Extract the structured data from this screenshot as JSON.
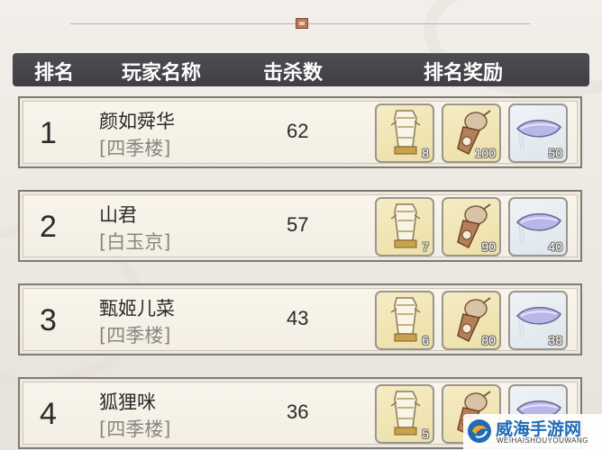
{
  "header": {
    "rank": "排名",
    "player_name": "玩家名称",
    "kills": "击杀数",
    "rewards": "排名奖励"
  },
  "rows": [
    {
      "rank": "1",
      "name": "颜如舜华",
      "guild": "[四季楼]",
      "kills": "62",
      "rewards": [
        "8",
        "100",
        "50"
      ]
    },
    {
      "rank": "2",
      "name": "山君",
      "guild": "[白玉京]",
      "kills": "57",
      "rewards": [
        "7",
        "90",
        "40"
      ]
    },
    {
      "rank": "3",
      "name": "甄姬儿菜",
      "guild": "[四季楼]",
      "kills": "43",
      "rewards": [
        "6",
        "80",
        "38"
      ]
    },
    {
      "rank": "4",
      "name": "狐狸咪",
      "guild": "[四季楼]",
      "kills": "36",
      "rewards": [
        "5",
        "",
        ""
      ]
    }
  ],
  "reward_icons": [
    "scroll-lantern-icon",
    "gourd-icon",
    "ingot-pillow-icon"
  ],
  "watermark": {
    "title": "威海手游网",
    "subtitle": "WEIHAISHOUYOUWANG"
  },
  "colors": {
    "header_bg": "#45454b",
    "row_bg": "#f6f1e7",
    "row_border": "#7f7a73",
    "reward_gold": "#f1e6b7",
    "reward_silver": "#e6edf1",
    "watermark_blue": "#1f6bb5"
  }
}
